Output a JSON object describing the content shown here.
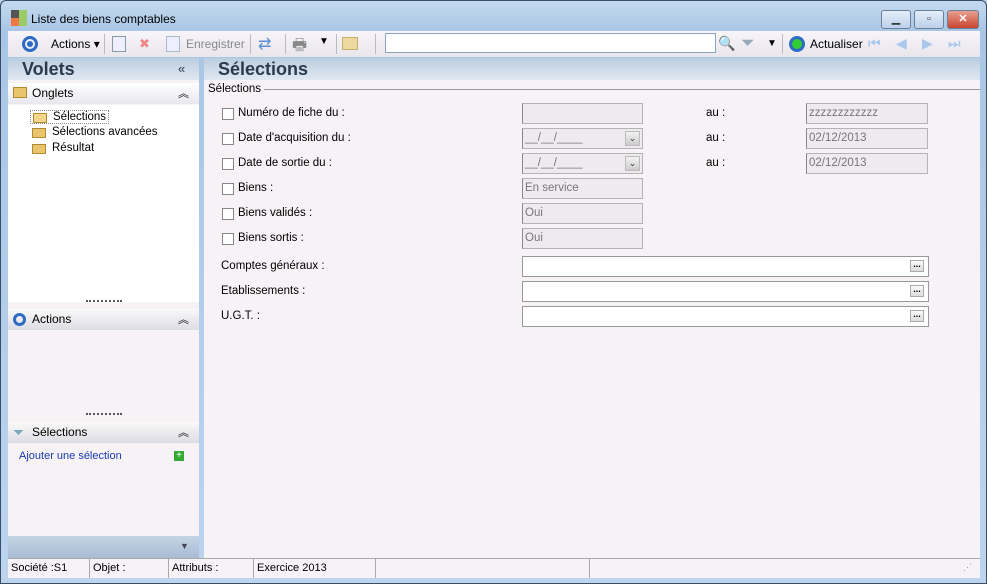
{
  "window": {
    "title": "Liste des biens comptables"
  },
  "toolbar": {
    "actions": "Actions",
    "save": "Enregistrer",
    "search_value": "",
    "refresh": "Actualiser"
  },
  "left": {
    "title": "Volets",
    "collapse": "«",
    "onglets": "Onglets",
    "tree": [
      "Sélections",
      "Sélections avancées",
      "Résultat"
    ],
    "actions": "Actions",
    "selections": "Sélections",
    "add_selection": "Ajouter une sélection"
  },
  "main": {
    "title": "Sélections",
    "group": "Sélections",
    "rows": [
      {
        "label": "Numéro de fiche du :",
        "from": "",
        "to_label": "au :",
        "to": "zzzzzzzzzzzz"
      },
      {
        "label": "Date d'acquisition du :",
        "from": "__/__/____",
        "to_label": "au :",
        "to": "02/12/2013"
      },
      {
        "label": "Date de sortie du :",
        "from": "__/__/____",
        "to_label": "au :",
        "to": "02/12/2013"
      },
      {
        "label": "Biens :",
        "from": "En service"
      },
      {
        "label": "Biens validés :",
        "from": "Oui"
      },
      {
        "label": "Biens sortis :",
        "from": "Oui"
      }
    ],
    "wide": [
      {
        "label": "Comptes généraux :",
        "value": ""
      },
      {
        "label": "Etablissements :",
        "value": ""
      },
      {
        "label": "U.G.T. :",
        "value": ""
      }
    ]
  },
  "status": {
    "societe": "Société :S1",
    "objet": "Objet :",
    "attributs": "Attributs :",
    "exercice": "Exercice 2013"
  }
}
